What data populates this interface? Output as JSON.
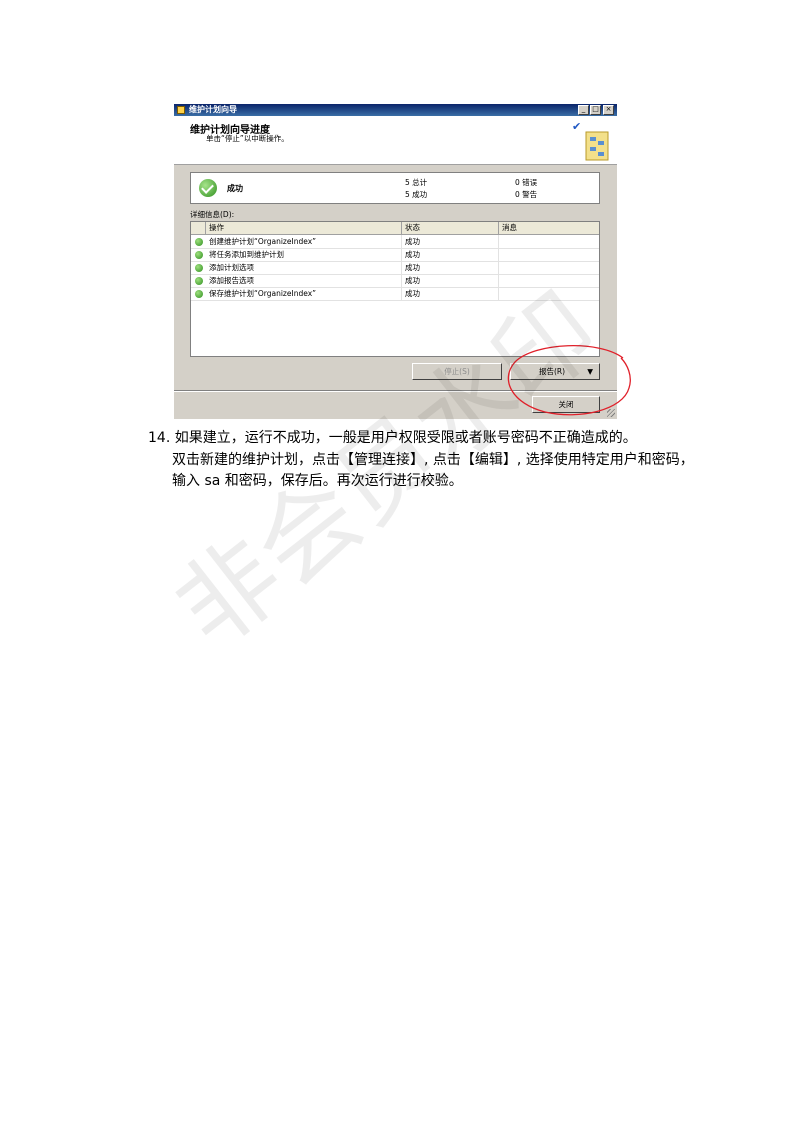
{
  "window": {
    "title": "维护计划向导",
    "controls": [
      "_",
      "□",
      "×"
    ],
    "heading": "维护计划向导进度",
    "subheading": "单击“停止”以中断操作。",
    "status": {
      "label": "成功",
      "total_label": "5 总计",
      "success_label": "5 成功",
      "error_label": "0 错误",
      "warning_label": "0 警告"
    },
    "details_label": "详细信息(D):",
    "grid": {
      "columns": [
        "操作",
        "状态",
        "消息"
      ],
      "rows": [
        {
          "action": "创建维护计划“OrganizeIndex”",
          "status": "成功",
          "message": ""
        },
        {
          "action": "将任务添加到维护计划",
          "status": "成功",
          "message": ""
        },
        {
          "action": "添加计划选项",
          "status": "成功",
          "message": ""
        },
        {
          "action": "添加报告选项",
          "status": "成功",
          "message": ""
        },
        {
          "action": "保存维护计划“OrganizeIndex”",
          "status": "成功",
          "message": ""
        }
      ]
    },
    "buttons": {
      "stop": "停止(S)",
      "report": "报告(R)",
      "close": "关闭"
    },
    "colors": {
      "success": "#2f8f1f",
      "annotation": "#e0202a"
    }
  },
  "document": {
    "number": "14.",
    "line1": "如果建立，运行不成功，一般是用户权限受限或者账号密码不正确造成的。",
    "line2": "双击新建的维护计划，点击【管理连接】, 点击【编辑】, 选择使用特定用户和密码，",
    "line3": "输入 sa 和密码，保存后。再次运行进行校验。"
  },
  "watermark": "非会员水印"
}
